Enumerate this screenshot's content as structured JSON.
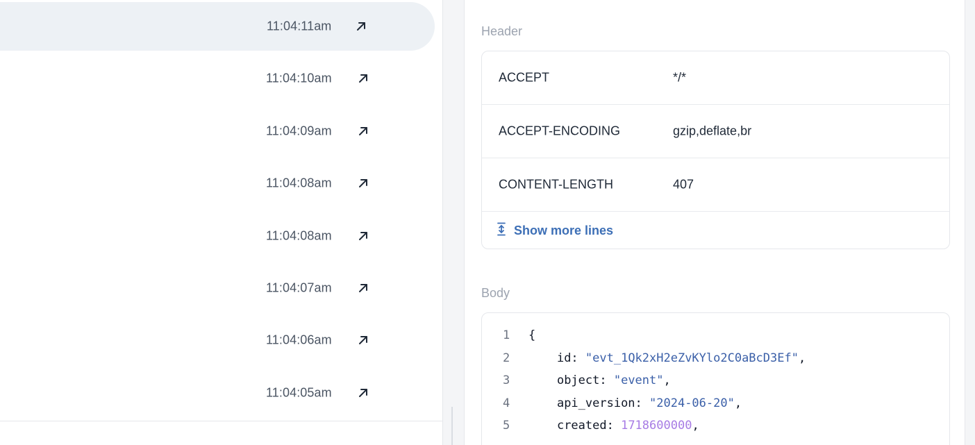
{
  "events": [
    {
      "time": "11:04:11am",
      "selected": true
    },
    {
      "time": "11:04:10am",
      "selected": false
    },
    {
      "time": "11:04:09am",
      "selected": false
    },
    {
      "time": "11:04:08am",
      "selected": false
    },
    {
      "time": "11:04:08am",
      "selected": false
    },
    {
      "time": "11:04:07am",
      "selected": false
    },
    {
      "time": "11:04:06am",
      "selected": false
    },
    {
      "time": "11:04:05am",
      "selected": false
    }
  ],
  "details": {
    "header_label": "Header",
    "headers": [
      {
        "key": "ACCEPT",
        "value": "*/*"
      },
      {
        "key": "ACCEPT-ENCODING",
        "value": "gzip,deflate,br"
      },
      {
        "key": "CONTENT-LENGTH",
        "value": "407"
      }
    ],
    "show_more_label": "Show more lines",
    "body_label": "Body",
    "body_lines": [
      {
        "num": "1",
        "indent": "",
        "key": "",
        "value": "{",
        "value_type": "plain",
        "trail": ""
      },
      {
        "num": "2",
        "indent": "    ",
        "key": "id: ",
        "value": "\"evt_1Qk2xH2eZvKYlo2C0aBcD3Ef\"",
        "value_type": "string",
        "trail": ","
      },
      {
        "num": "3",
        "indent": "    ",
        "key": "object: ",
        "value": "\"event\"",
        "value_type": "string",
        "trail": ","
      },
      {
        "num": "4",
        "indent": "    ",
        "key": "api_version: ",
        "value": "\"2024-06-20\"",
        "value_type": "string",
        "trail": ","
      },
      {
        "num": "5",
        "indent": "    ",
        "key": "created: ",
        "value": "1718600000",
        "value_type": "number",
        "trail": ","
      }
    ]
  },
  "colors": {
    "selected_row": "#edf1f5",
    "link_blue": "#3d6fb6",
    "string_blue": "#3a5fa8",
    "number_purple": "#a77be4"
  },
  "icons": {
    "row_open": "arrow-up-right-icon",
    "show_more": "expand-vertical-icon"
  }
}
